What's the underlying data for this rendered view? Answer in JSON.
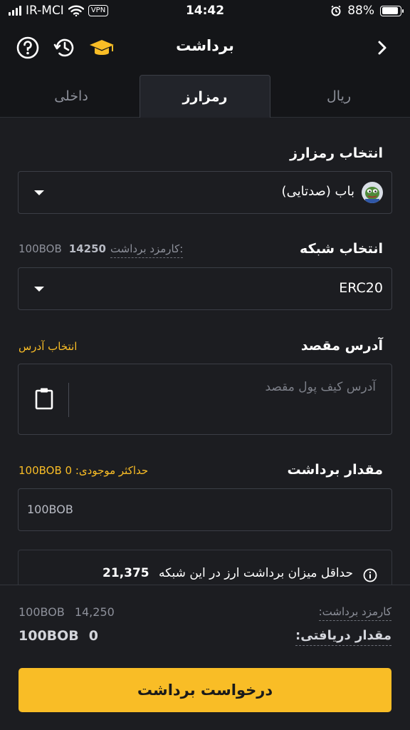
{
  "status": {
    "carrier": "IR-MCI",
    "vpn": "VPN",
    "time": "14:42",
    "battery": "88%",
    "battery_level": 0.88
  },
  "header": {
    "title": "برداشت",
    "icons": [
      "help-icon",
      "history-icon",
      "graduation-cap-icon",
      "chevron-right-icon"
    ]
  },
  "tabs": [
    {
      "label": "ریال",
      "active": false
    },
    {
      "label": "رمزارز",
      "active": true
    },
    {
      "label": "داخلی",
      "active": false
    }
  ],
  "coin": {
    "label": "انتخاب رمزارز",
    "selected": "باب (صدتایی)"
  },
  "network": {
    "label": "انتخاب شبکه",
    "fee_label": "کارمزد برداشت:",
    "fee_value": "14250",
    "fee_unit": "100BOB",
    "selected": "ERC20"
  },
  "address": {
    "label": "آدرس مقصد",
    "select_link": "انتخاب آدرس",
    "placeholder": "آدرس کیف پول مقصد"
  },
  "amount": {
    "label": "مقدار برداشت",
    "max_label": "حداکثر موجودی: 0 100BOB",
    "placeholder": "100BOB"
  },
  "info": {
    "text": "حداقل میزان برداشت ارز در این شبکه",
    "value": "21,375"
  },
  "summary": {
    "fee_label": "کارمزد برداشت:",
    "fee_value": "14,250",
    "fee_unit": "100BOB",
    "receive_label": "مقدار دریافتی:",
    "receive_value": "0",
    "receive_unit": "100BOB"
  },
  "submit_label": "درخواست برداشت",
  "colors": {
    "accent": "#f9bd26",
    "background": "#1c1d21",
    "bar": "#141518",
    "border": "#3b3e46"
  }
}
